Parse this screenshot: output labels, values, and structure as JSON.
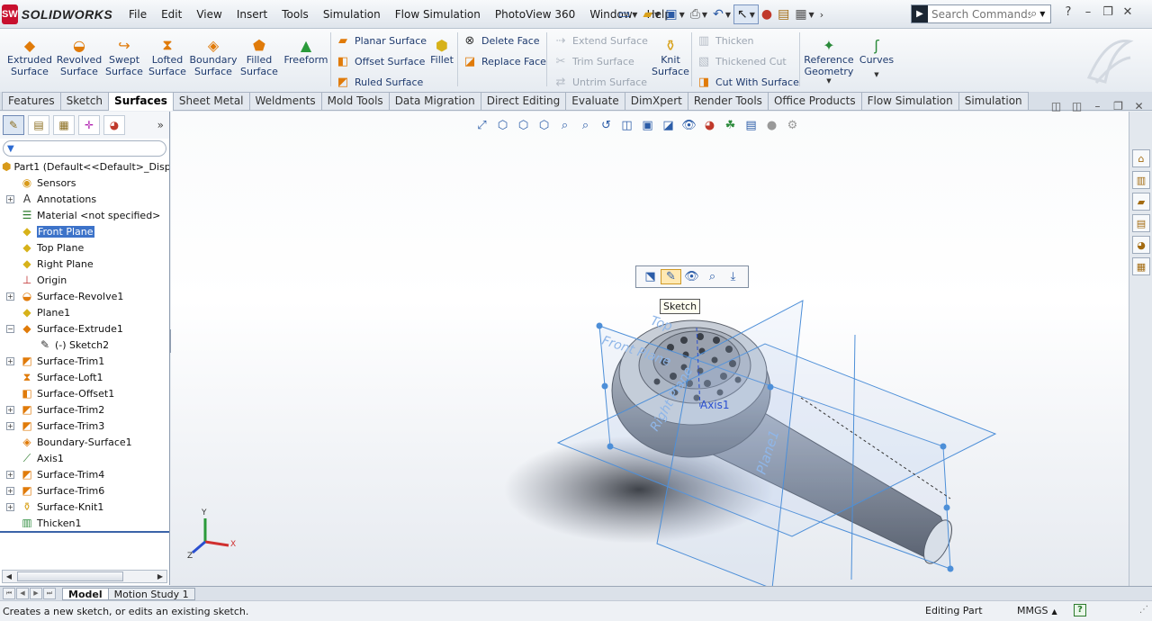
{
  "app": {
    "brand_badge": "SW",
    "brand_name": "SOLIDWORKS"
  },
  "menu": [
    "File",
    "Edit",
    "View",
    "Insert",
    "Tools",
    "Simulation",
    "Flow Simulation",
    "PhotoView 360",
    "Window",
    "Help"
  ],
  "quick_access_icons": [
    "pin-icon",
    "new-document-icon",
    "open-icon",
    "save-icon",
    "print-icon",
    "undo-icon",
    "select-icon",
    "rebuild-icon",
    "file-properties-icon",
    "options-icon"
  ],
  "search": {
    "placeholder": "Search Commands"
  },
  "ribbon": {
    "big": [
      {
        "label": "Extruded\nSurface",
        "name": "extruded-surface-button"
      },
      {
        "label": "Revolved\nSurface",
        "name": "revolved-surface-button"
      },
      {
        "label": "Swept\nSurface",
        "name": "swept-surface-button"
      },
      {
        "label": "Lofted\nSurface",
        "name": "lofted-surface-button"
      },
      {
        "label": "Boundary\nSurface",
        "name": "boundary-surface-button"
      },
      {
        "label": "Filled\nSurface",
        "name": "filled-surface-button"
      },
      {
        "label": "Freeform",
        "name": "freeform-button"
      },
      {
        "label": "Fillet",
        "name": "fillet-button"
      },
      {
        "label": "Knit\nSurface",
        "name": "knit-surface-button"
      },
      {
        "label": "Reference\nGeometry",
        "name": "reference-geometry-button"
      },
      {
        "label": "Curves",
        "name": "curves-button"
      }
    ],
    "small": [
      {
        "label": "Planar Surface",
        "enabled": true
      },
      {
        "label": "Offset Surface",
        "enabled": true
      },
      {
        "label": "Ruled Surface",
        "enabled": true
      },
      {
        "label": "Delete Face",
        "enabled": true
      },
      {
        "label": "Replace Face",
        "enabled": true
      },
      {
        "label": "Extend Surface",
        "enabled": false
      },
      {
        "label": "Trim Surface",
        "enabled": false
      },
      {
        "label": "Untrim Surface",
        "enabled": false
      },
      {
        "label": "Thicken",
        "enabled": false
      },
      {
        "label": "Thickened Cut",
        "enabled": false
      },
      {
        "label": "Cut With Surface",
        "enabled": true
      }
    ]
  },
  "tabs": [
    "Features",
    "Sketch",
    "Surfaces",
    "Sheet Metal",
    "Weldments",
    "Mold Tools",
    "Data Migration",
    "Direct Editing",
    "Evaluate",
    "DimXpert",
    "Render Tools",
    "Office Products",
    "Flow Simulation",
    "Simulation"
  ],
  "active_tab": "Surfaces",
  "tree": [
    {
      "label": "Part1  (Default<<Default>_Displa",
      "icon": "part-icon",
      "level": 0,
      "expand": "none"
    },
    {
      "label": "Sensors",
      "icon": "sensors-icon",
      "level": 1,
      "expand": "none"
    },
    {
      "label": "Annotations",
      "icon": "annotations-icon",
      "level": 1,
      "expand": "plus"
    },
    {
      "label": "Material <not specified>",
      "icon": "material-icon",
      "level": 1,
      "expand": "none"
    },
    {
      "label": "Front Plane",
      "icon": "plane-icon",
      "level": 1,
      "expand": "none",
      "selected": true
    },
    {
      "label": "Top Plane",
      "icon": "plane-icon",
      "level": 1,
      "expand": "none"
    },
    {
      "label": "Right Plane",
      "icon": "plane-icon",
      "level": 1,
      "expand": "none"
    },
    {
      "label": "Origin",
      "icon": "origin-icon",
      "level": 1,
      "expand": "none"
    },
    {
      "label": "Surface-Revolve1",
      "icon": "surface-revolve-icon",
      "level": 1,
      "expand": "plus"
    },
    {
      "label": "Plane1",
      "icon": "plane-icon",
      "level": 1,
      "expand": "none"
    },
    {
      "label": "Surface-Extrude1",
      "icon": "surface-extrude-icon",
      "level": 1,
      "expand": "minus"
    },
    {
      "label": "(-) Sketch2",
      "icon": "sketch-icon",
      "level": 2,
      "expand": "none"
    },
    {
      "label": "Surface-Trim1",
      "icon": "surface-trim-icon",
      "level": 1,
      "expand": "plus"
    },
    {
      "label": "Surface-Loft1",
      "icon": "surface-loft-icon",
      "level": 1,
      "expand": "none"
    },
    {
      "label": "Surface-Offset1",
      "icon": "surface-offset-icon",
      "level": 1,
      "expand": "none"
    },
    {
      "label": "Surface-Trim2",
      "icon": "surface-trim-icon",
      "level": 1,
      "expand": "plus"
    },
    {
      "label": "Surface-Trim3",
      "icon": "surface-trim-icon",
      "level": 1,
      "expand": "plus"
    },
    {
      "label": "Boundary-Surface1",
      "icon": "boundary-surface-icon",
      "level": 1,
      "expand": "none"
    },
    {
      "label": "Axis1",
      "icon": "axis-icon",
      "level": 1,
      "expand": "none"
    },
    {
      "label": "Surface-Trim4",
      "icon": "surface-trim-icon",
      "level": 1,
      "expand": "plus"
    },
    {
      "label": "Surface-Trim6",
      "icon": "surface-trim-icon",
      "level": 1,
      "expand": "plus"
    },
    {
      "label": "Surface-Knit1",
      "icon": "surface-knit-icon",
      "level": 1,
      "expand": "plus"
    },
    {
      "label": "Thicken1",
      "icon": "thicken-icon",
      "level": 1,
      "expand": "none"
    }
  ],
  "viewport": {
    "tooltip": "Sketch",
    "plane_labels": {
      "front": "Front Plane",
      "top": "Top",
      "right": "Right Plane",
      "plane1": "Plane1",
      "axis": "Axis1"
    },
    "triad": {
      "x": "X",
      "y": "Y",
      "z": "Z"
    }
  },
  "bottom_tabs": [
    "Model",
    "Motion Study 1"
  ],
  "active_bottom_tab": "Model",
  "status": {
    "text": "Creates a new sketch, or edits an existing sketch.",
    "mode": "Editing Part",
    "units": "MMGS",
    "help": "?"
  }
}
